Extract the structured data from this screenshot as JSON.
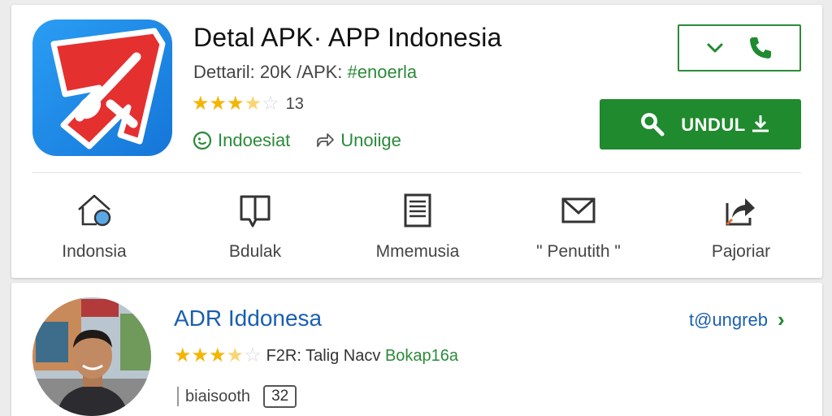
{
  "app": {
    "title": "Detal APK· APP Indonesia",
    "sub_prefix": "Dettaril: 20K /APK: ",
    "sub_tag": "#enoerla",
    "rating_stars": 3.5,
    "rating_count": "13",
    "meta_publisher": "Indoesiat",
    "meta_share": "Unoiige"
  },
  "buttons": {
    "download_label": "UNDUL"
  },
  "actions": [
    {
      "label": "Indonsia",
      "icon": "home-search-icon"
    },
    {
      "label": "Bdulak",
      "icon": "book-icon"
    },
    {
      "label": "Mmemusia",
      "icon": "document-list-icon"
    },
    {
      "label": "\" Penutith \"",
      "icon": "mail-icon"
    },
    {
      "label": "Pajoriar",
      "icon": "share-arrow-icon"
    }
  ],
  "developer": {
    "name": "ADR Iddonesa",
    "link": "t@ungreb",
    "rating_stars": 3.5,
    "rating_text": "F2R: Talig Nacv ",
    "rating_highlight": "Bokap16a",
    "footer_text": "biaisooth",
    "badge": "32"
  },
  "colors": {
    "accent_green": "#1f8a2e",
    "link_blue": "#1a5fb0",
    "star": "#f5b400",
    "icon_blue": "#1576d8",
    "icon_red": "#e53030"
  }
}
